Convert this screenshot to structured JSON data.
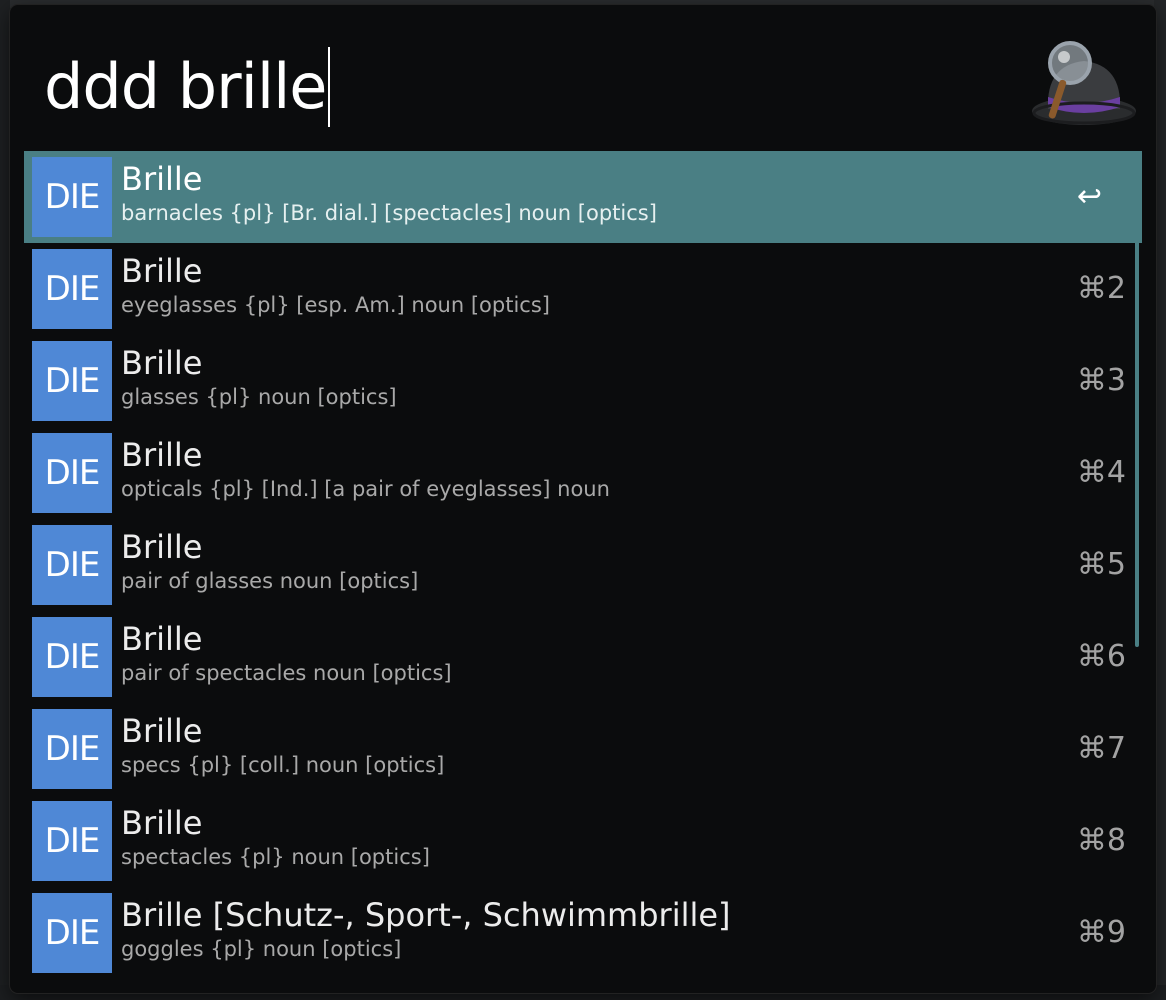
{
  "search": {
    "query": "ddd brille"
  },
  "results": [
    {
      "badge": "DIE",
      "title": "Brille",
      "subtitle": "barnacles {pl} [Br. dial.] [spectacles] noun [optics]",
      "shortcut": "↩",
      "selected": true
    },
    {
      "badge": "DIE",
      "title": "Brille",
      "subtitle": "eyeglasses {pl} [esp. Am.] noun [optics]",
      "shortcut": "⌘2"
    },
    {
      "badge": "DIE",
      "title": "Brille",
      "subtitle": "glasses {pl} noun [optics]",
      "shortcut": "⌘3"
    },
    {
      "badge": "DIE",
      "title": "Brille",
      "subtitle": "opticals {pl} [Ind.] [a pair of eyeglasses] noun",
      "shortcut": "⌘4"
    },
    {
      "badge": "DIE",
      "title": "Brille",
      "subtitle": "pair of glasses noun [optics]",
      "shortcut": "⌘5"
    },
    {
      "badge": "DIE",
      "title": "Brille",
      "subtitle": "pair of spectacles noun [optics]",
      "shortcut": "⌘6"
    },
    {
      "badge": "DIE",
      "title": "Brille",
      "subtitle": "specs {pl} [coll.] noun [optics]",
      "shortcut": "⌘7"
    },
    {
      "badge": "DIE",
      "title": "Brille",
      "subtitle": "spectacles {pl} noun [optics]",
      "shortcut": "⌘8"
    },
    {
      "badge": "DIE",
      "title": "Brille  [Schutz-, Sport-, Schwimmbrille]",
      "subtitle": "goggles {pl} noun [optics]",
      "shortcut": "⌘9"
    }
  ],
  "colors": {
    "panel_background": "#0b0c0d",
    "selection": "#4a7f84",
    "badge": "#4f88d6"
  },
  "icons": {
    "logo": "alfred-hat-magnifier-icon"
  }
}
